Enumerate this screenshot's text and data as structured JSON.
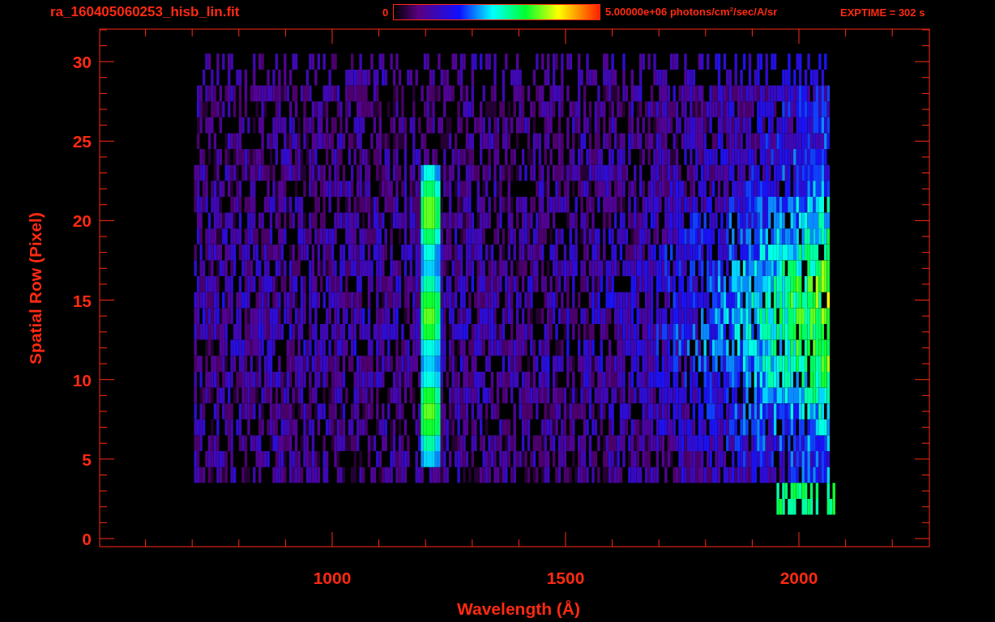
{
  "title": "ra_160405060253_hisb_lin.fit",
  "colorbar": {
    "min_label": "0",
    "max_label": "5.00000e+06 photons/cm$^{2}$/sec/A/sr"
  },
  "exposure": "EXPTIME = 302 s",
  "x_axis": {
    "label": "Wavelength (Å)",
    "ticks": [
      "1000",
      "1500",
      "2000"
    ]
  },
  "y_axis": {
    "label": "Spatial Row (Pixel)",
    "ticks": [
      "30",
      "25",
      "20",
      "15",
      "10",
      "5",
      "0"
    ]
  }
}
